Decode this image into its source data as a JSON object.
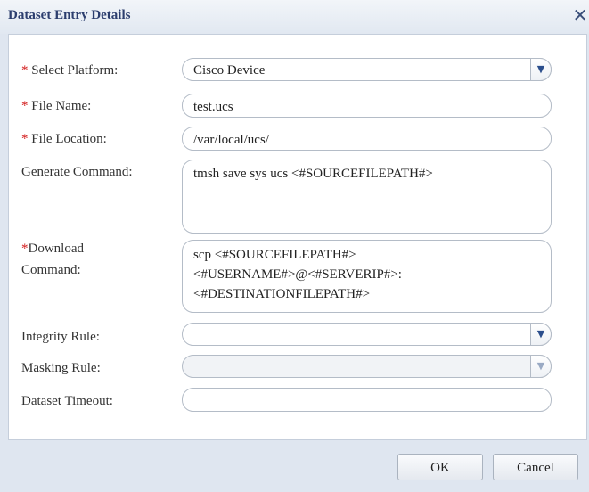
{
  "dialog": {
    "title": "Dataset Entry Details",
    "close_glyph": "✕"
  },
  "form": {
    "required_marker": "*",
    "platform": {
      "label": "Select Platform:",
      "value": "Cisco Device",
      "required": true
    },
    "file_name": {
      "label": "File Name:",
      "value": "test.ucs",
      "required": true
    },
    "file_location": {
      "label": "File Location:",
      "value": "/var/local/ucs/",
      "required": true
    },
    "generate_command": {
      "label": "Generate Command:",
      "value": "tmsh save sys ucs <#SOURCEFILEPATH#>",
      "required": false
    },
    "download_command": {
      "label_line1": "Download",
      "label_line2": "Command:",
      "value_lines": [
        "scp <#SOURCEFILEPATH#>",
        "<#USERNAME#>@<#SERVERIP#>:",
        "<#DESTINATIONFILEPATH#>"
      ],
      "required": true
    },
    "integrity_rule": {
      "label": "Integrity Rule:",
      "value": "",
      "required": false
    },
    "masking_rule": {
      "label": "Masking Rule:",
      "value": "",
      "required": false,
      "disabled": true
    },
    "dataset_timeout": {
      "label": "Dataset Timeout:",
      "value": "",
      "required": false
    }
  },
  "buttons": {
    "ok_label": "OK",
    "cancel_label": "Cancel"
  },
  "icons": {
    "dropdown": "chevron-down-icon",
    "close": "close-icon"
  },
  "colors": {
    "title": "#2c3e6e",
    "required_marker": "#d21c1c",
    "dropdown_arrow": "#2b4e8c"
  }
}
